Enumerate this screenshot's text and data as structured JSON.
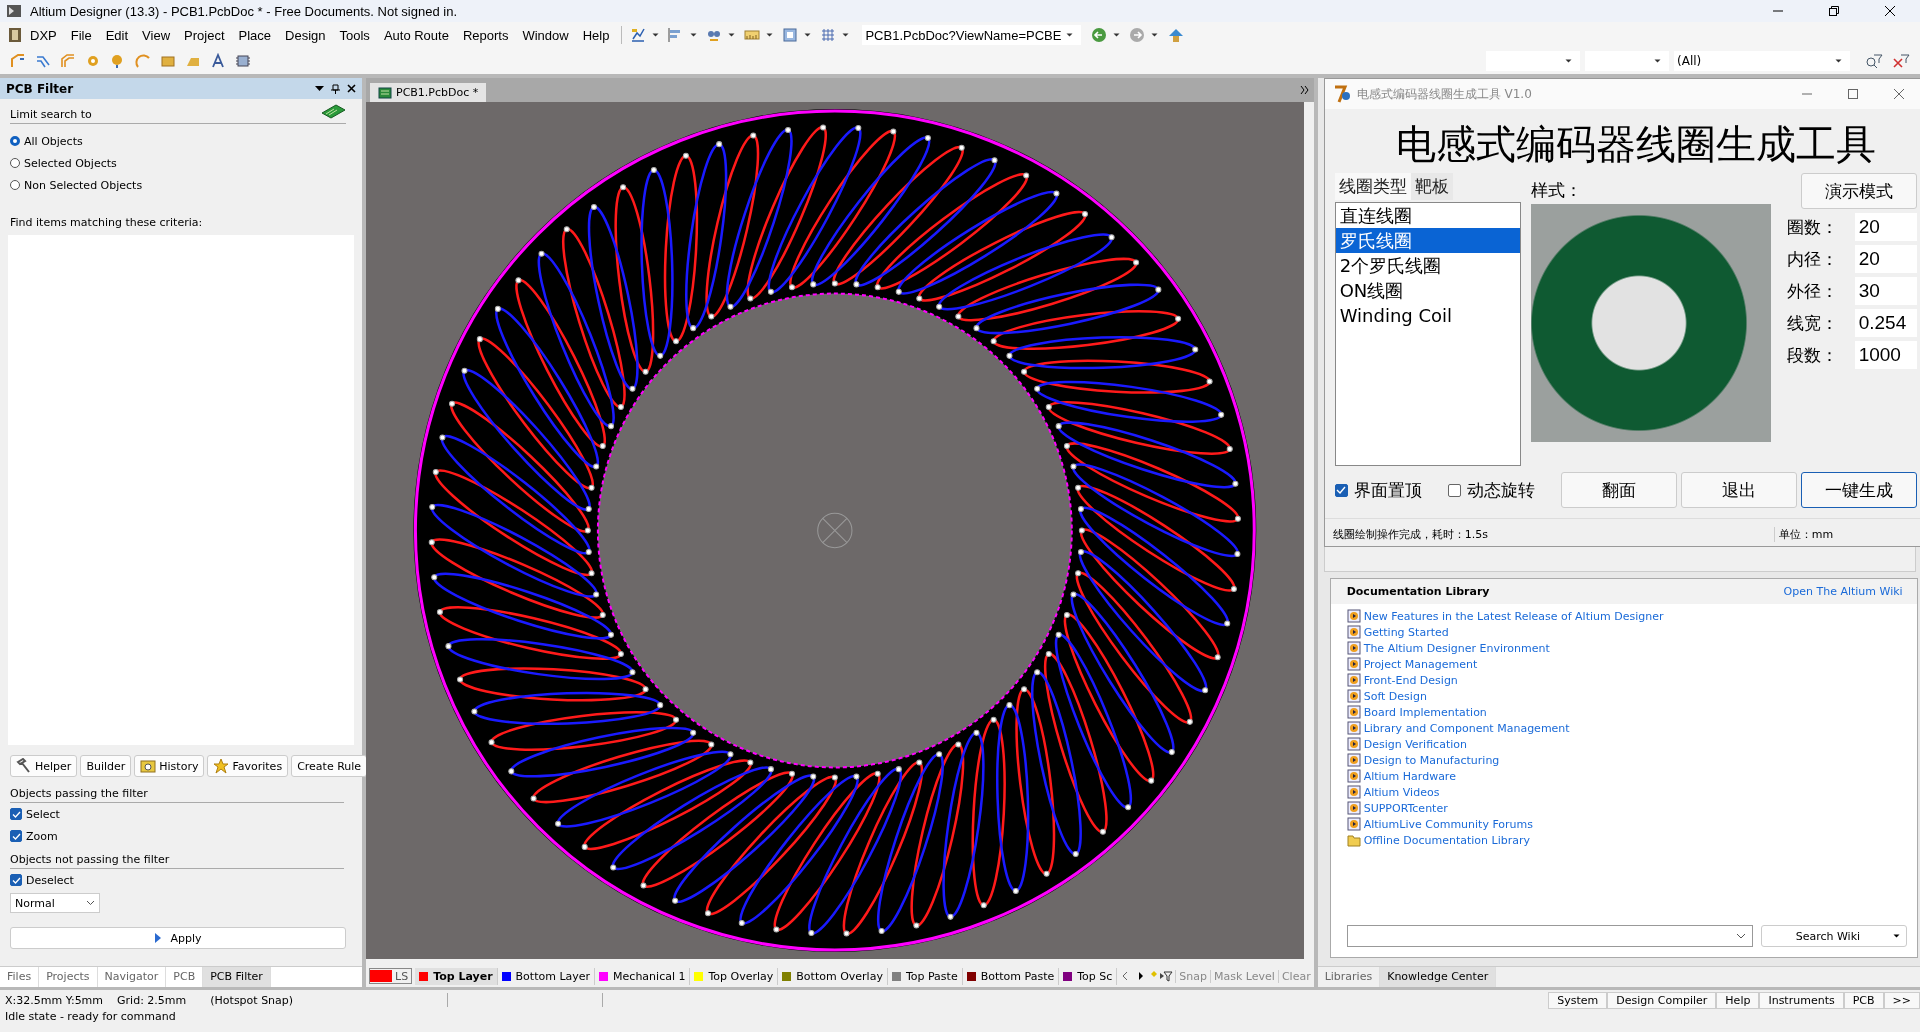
{
  "window": {
    "title": "Altium Designer (13.3) - PCB1.PcbDoc * - Free Documents. Not signed in."
  },
  "menu": [
    "DXP",
    "File",
    "Edit",
    "View",
    "Project",
    "Place",
    "Design",
    "Tools",
    "Auto Route",
    "Reports",
    "Window",
    "Help"
  ],
  "view_combo": "PCB1.PcbDoc?ViewName=PCBE",
  "filter_combo": "(All)",
  "pcb_filter": {
    "title": "PCB Filter",
    "limit_label": "Limit search to",
    "options": [
      {
        "label": "All Objects",
        "selected": true
      },
      {
        "label": "Selected Objects",
        "selected": false
      },
      {
        "label": "Non Selected Objects",
        "selected": false
      }
    ],
    "criteria_label": "Find items matching these criteria:",
    "buttons": [
      "Helper",
      "Builder",
      "History",
      "Favorites",
      "Create Rule"
    ],
    "passing_heading": "Objects passing the filter",
    "passing": [
      {
        "label": "Select",
        "checked": true
      },
      {
        "label": "Zoom",
        "checked": true
      }
    ],
    "not_passing_heading": "Objects not passing the filter",
    "not_passing": [
      {
        "label": "Deselect",
        "checked": true
      }
    ],
    "mode": "Normal",
    "apply": "Apply"
  },
  "left_tabs": [
    {
      "label": "Files",
      "selected": false
    },
    {
      "label": "Projects",
      "selected": false
    },
    {
      "label": "Navigator",
      "selected": false
    },
    {
      "label": "PCB",
      "selected": false
    },
    {
      "label": "PCB Filter",
      "selected": true
    }
  ],
  "document_tab": "PCB1.PcbDoc *",
  "layers": {
    "current": "LS",
    "items": [
      {
        "label": "Top Layer",
        "color": "#ff0000",
        "selected": true
      },
      {
        "label": "Bottom Layer",
        "color": "#0000ff",
        "selected": false
      },
      {
        "label": "Mechanical 1",
        "color": "#ff00ff",
        "selected": false
      },
      {
        "label": "Top Overlay",
        "color": "#ffff00",
        "selected": false
      },
      {
        "label": "Bottom Overlay",
        "color": "#808000",
        "selected": false
      },
      {
        "label": "Top Paste",
        "color": "#808080",
        "selected": false
      },
      {
        "label": "Bottom Paste",
        "color": "#800000",
        "selected": false
      },
      {
        "label": "Top Sc",
        "color": "#800080",
        "selected": false
      }
    ],
    "buttons": [
      "Snap",
      "Mask Level",
      "Clear"
    ]
  },
  "tool_window": {
    "title": "电感式编码器线圈生成工具 V1.0",
    "heading": "电感式编码器线圈生成工具",
    "tabs": [
      {
        "label": "线圈类型",
        "selected": true
      },
      {
        "label": "靶板",
        "selected": false
      }
    ],
    "style_label": "样式：",
    "demo_button": "演示模式",
    "list": [
      {
        "label": "直连线圈",
        "selected": false
      },
      {
        "label": "罗氏线圈",
        "selected": true
      },
      {
        "label": "2个罗氏线圈",
        "selected": false
      },
      {
        "label": "ON线圈",
        "selected": false
      },
      {
        "label": "Winding Coil",
        "selected": false
      }
    ],
    "params": [
      {
        "label": "圈数：",
        "value": "20"
      },
      {
        "label": "内径：",
        "value": "20"
      },
      {
        "label": "外径：",
        "value": "30"
      },
      {
        "label": "线宽：",
        "value": "0.254"
      },
      {
        "label": "段数：",
        "value": "1000"
      }
    ],
    "checkboxes": [
      {
        "label": "界面置顶",
        "checked": true
      },
      {
        "label": "动态旋转",
        "checked": false
      }
    ],
    "buttons": [
      "翻面",
      "退出",
      "一键生成"
    ],
    "status": "线圈绘制操作完成，耗时：1.5s",
    "unit": "单位：mm"
  },
  "doc_library": {
    "title": "Documentation Library",
    "wiki_link": "Open The Altium Wiki",
    "links": [
      {
        "label": "New Features in the Latest Release of Altium Designer",
        "kind": "doc"
      },
      {
        "label": "Getting Started",
        "kind": "doc"
      },
      {
        "label": "The Altium Designer Environment",
        "kind": "doc"
      },
      {
        "label": "Project Management",
        "kind": "doc"
      },
      {
        "label": "Front-End Design",
        "kind": "doc"
      },
      {
        "label": "Soft Design",
        "kind": "doc"
      },
      {
        "label": "Board Implementation",
        "kind": "doc"
      },
      {
        "label": "Library and Component Management",
        "kind": "doc"
      },
      {
        "label": "Design Verification",
        "kind": "doc"
      },
      {
        "label": "Design to Manufacturing",
        "kind": "doc"
      },
      {
        "label": "Altium Hardware",
        "kind": "doc"
      },
      {
        "label": "Altium Videos",
        "kind": "doc"
      },
      {
        "label": "SUPPORTcenter",
        "kind": "doc"
      },
      {
        "label": "AltiumLive Community Forums",
        "kind": "doc"
      },
      {
        "label": "Offline Documentation Library",
        "kind": "folder"
      }
    ],
    "search_button": "Search Wiki"
  },
  "right_tabs": [
    {
      "label": "Libraries",
      "selected": false
    },
    {
      "label": "Knowledge Center",
      "selected": true
    }
  ],
  "status": {
    "coords": "X:32.5mm Y:5mm",
    "grid": "Grid: 2.5mm",
    "snap": "(Hotspot Snap)",
    "message": "Idle state - ready for command",
    "buttons": [
      "System",
      "Design Compiler",
      "Help",
      "Instruments",
      "PCB",
      ">>"
    ]
  }
}
